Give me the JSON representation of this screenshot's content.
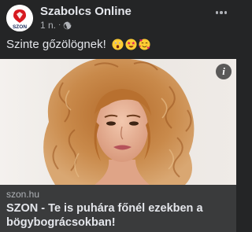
{
  "post": {
    "page_name": "Szabolcs Online",
    "avatar_text": "SZON",
    "timestamp": "1 n.",
    "separator": "·",
    "privacy_icon": "globe-icon",
    "more_icon": "more-options-icon",
    "caption": "Szinte gőzölögnek!",
    "caption_emojis": [
      "astonished-face-emoji",
      "star-struck-emoji",
      "smiling-face-with-hearts-emoji"
    ]
  },
  "link": {
    "info_icon_text": "i",
    "domain": "szon.hu",
    "title": "SZON - Te is puhára főnél ezekben a bögybográcsokban!"
  },
  "colors": {
    "background": "#242526",
    "link_footer": "#3a3b3c",
    "text_primary": "#e4e6eb",
    "text_secondary": "#b0b3b8",
    "brand_red": "#d71920"
  }
}
